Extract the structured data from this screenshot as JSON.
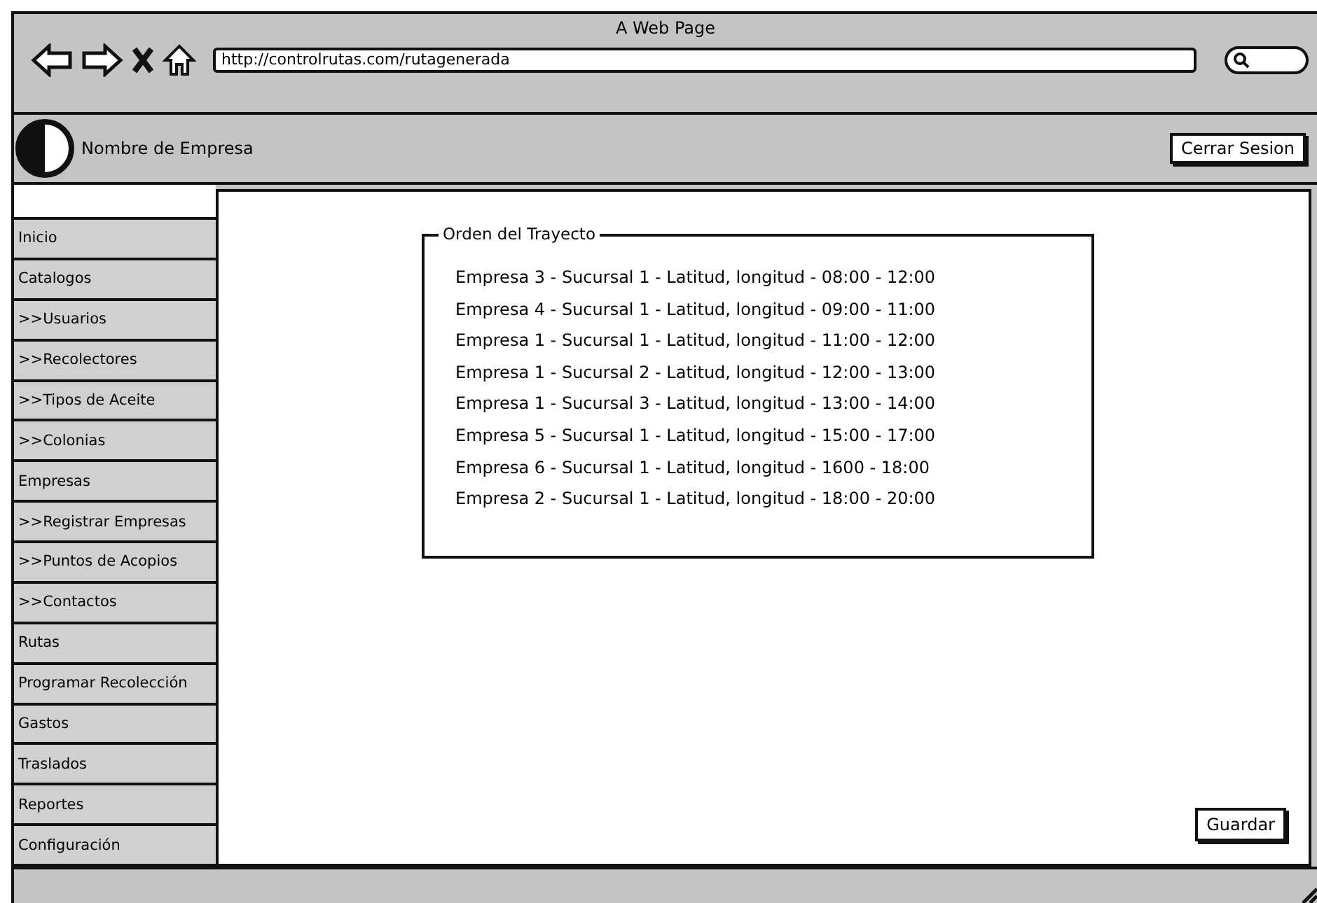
{
  "window": {
    "title": "A Web Page"
  },
  "browser": {
    "url": "http://controlrutas.com/rutagenerada"
  },
  "header": {
    "company": "Nombre de Empresa",
    "logout_button": "Cerrar Sesion"
  },
  "sidebar": {
    "items": [
      {
        "label": "Inicio"
      },
      {
        "label": "Catalogos"
      },
      {
        "label": ">>Usuarios"
      },
      {
        "label": ">>Recolectores"
      },
      {
        "label": ">>Tipos de Aceite"
      },
      {
        "label": ">>Colonias"
      },
      {
        "label": "Empresas"
      },
      {
        "label": ">>Registrar Empresas"
      },
      {
        "label": ">>Puntos de Acopios"
      },
      {
        "label": ">>Contactos"
      },
      {
        "label": "Rutas"
      },
      {
        "label": "Programar Recolección"
      },
      {
        "label": "Gastos"
      },
      {
        "label": "Traslados"
      },
      {
        "label": "Reportes"
      },
      {
        "label": "Configuración"
      }
    ]
  },
  "route_group": {
    "title": "Orden del Trayecto",
    "stops": [
      "Empresa 3 - Sucursal 1 - Latitud, longitud - 08:00 - 12:00",
      "Empresa 4 - Sucursal 1 - Latitud, longitud - 09:00 - 11:00",
      "Empresa 1 - Sucursal 1 - Latitud, longitud - 11:00 - 12:00",
      "Empresa 1 - Sucursal 2 - Latitud, longitud - 12:00 - 13:00",
      "Empresa 1 - Sucursal 3 - Latitud, longitud - 13:00 - 14:00",
      "Empresa 5 - Sucursal 1 - Latitud, longitud - 15:00 - 17:00",
      "Empresa 6 - Sucursal 1 - Latitud, longitud - 1600 - 18:00",
      "Empresa 2 - Sucursal 1 - Latitud, longitud - 18:00 - 20:00"
    ]
  },
  "save_button": "Guardar"
}
